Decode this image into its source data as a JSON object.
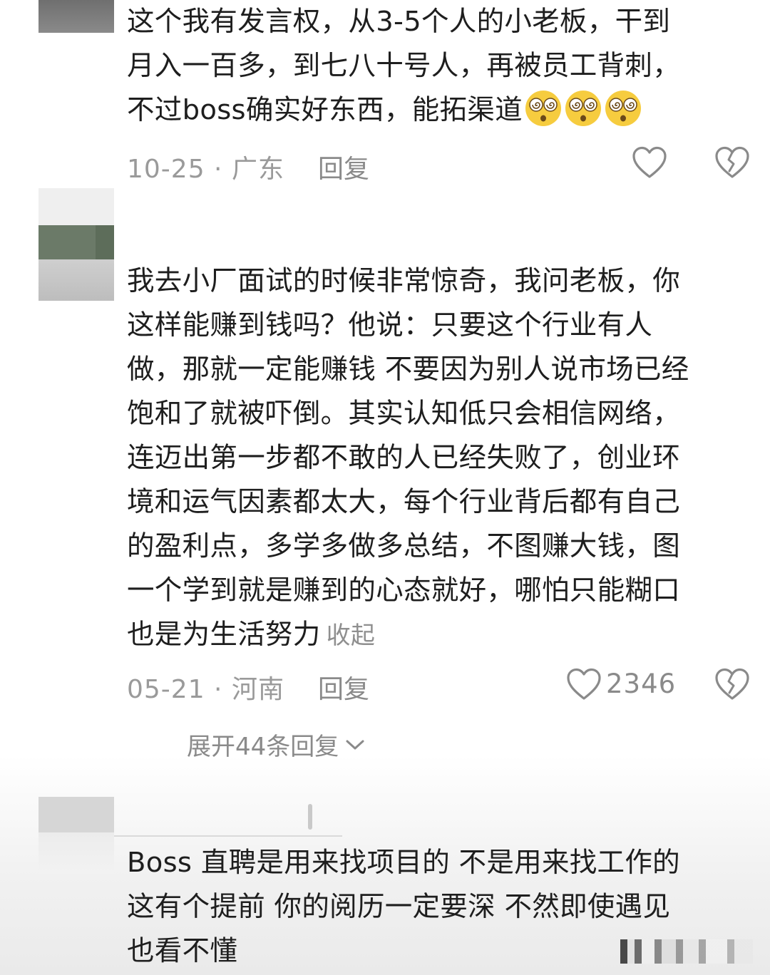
{
  "comments": [
    {
      "lines": [
        "这个我有发言权，从3-5个人的小老板，干到",
        "月入一百多，到七八十号人，再被员工背刺，",
        "不过boss确实好东西，能拓渠道"
      ],
      "emoji_name": "dizzy-face-emoji",
      "date_location": "10-25 · 广东",
      "reply_label": "回复",
      "like_icon": "heart-outline-icon",
      "dislike_icon": "broken-heart-icon"
    },
    {
      "lines": [
        "我去小厂面试的时候非常惊奇，我问老板，你",
        "这样能赚到钱吗？他说：只要这个行业有人",
        "做，那就一定能赚钱 不要因为别人说市场已经",
        "饱和了就被吓倒。其实认知低只会相信网络，",
        "连迈出第一步都不敢的人已经失败了，创业环",
        "境和运气因素都太大，每个行业背后都有自己",
        "的盈利点，多学多做多总结，不图赚大钱，图",
        "一个学到就是赚到的心态就好，哪怕只能糊口",
        "也是为生活努力"
      ],
      "collapse_label": "收起",
      "date_location": "05-21 · 河南",
      "reply_label": "回复",
      "like_count": "2346",
      "like_icon": "heart-outline-icon",
      "dislike_icon": "broken-heart-icon",
      "expand_replies_label": "展开44条回复",
      "expand_icon": "chevron-down-icon"
    },
    {
      "lines": [
        "Boss 直聘是用来找项目的 不是用来找工作的",
        "这有个提前 你的阅历一定要深 不然即使遇见",
        "也看不懂"
      ]
    }
  ],
  "colors": {
    "text": "#1e1e1e",
    "meta": "#9a9a9a",
    "background": "#ffffff"
  }
}
